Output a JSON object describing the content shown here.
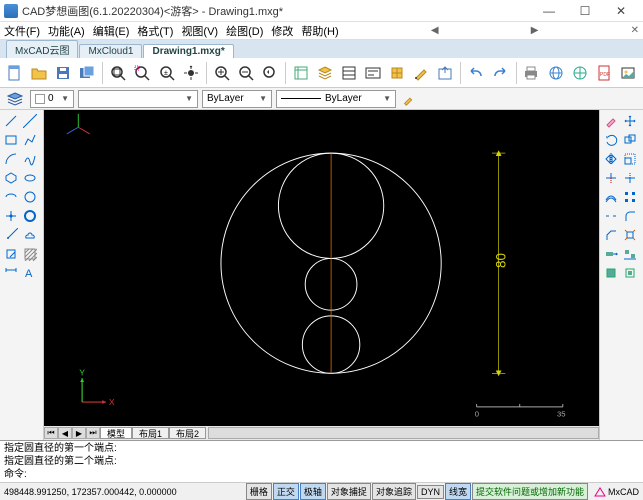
{
  "window": {
    "title": "CAD梦想画图(6.1.20220304)<游客> - Drawing1.mxg*",
    "min": "—",
    "max": "☐",
    "close": "✕"
  },
  "menu": {
    "file": "文件(F)",
    "func": "功能(A)",
    "edit": "编辑(E)",
    "fmt": "格式(T)",
    "view": "视图(V)",
    "draw": "绘图(D)",
    "mod": "修改",
    "help": "帮助(H)"
  },
  "tabs": {
    "t1": "MxCAD云图",
    "t2": "MxCloud1",
    "t3": "Drawing1.mxg*"
  },
  "props": {
    "layer0": "0",
    "bylayer1": "ByLayer",
    "bylayer2": "ByLayer"
  },
  "modeltabs": {
    "model": "模型",
    "l1": "布局1",
    "l2": "布局2"
  },
  "cmd": {
    "l1": "指定圆直径的第一个端点:",
    "l2": "指定圆直径的第二个端点:",
    "l3": "命令:"
  },
  "status": {
    "coords": "498448.991250, 172357.000442, 0.000000",
    "grid": "栅格",
    "ortho": "正交",
    "polar": "极轴",
    "osnap": "对象捕捉",
    "otrack": "对象追踪",
    "dyn": "DYN",
    "lw": "线宽",
    "feedback": "提交软件问题或增加新功能",
    "brand": "MxCAD"
  },
  "dim": {
    "value": "80"
  },
  "scale": {
    "a": "0",
    "b": "35"
  },
  "chart_data": null
}
